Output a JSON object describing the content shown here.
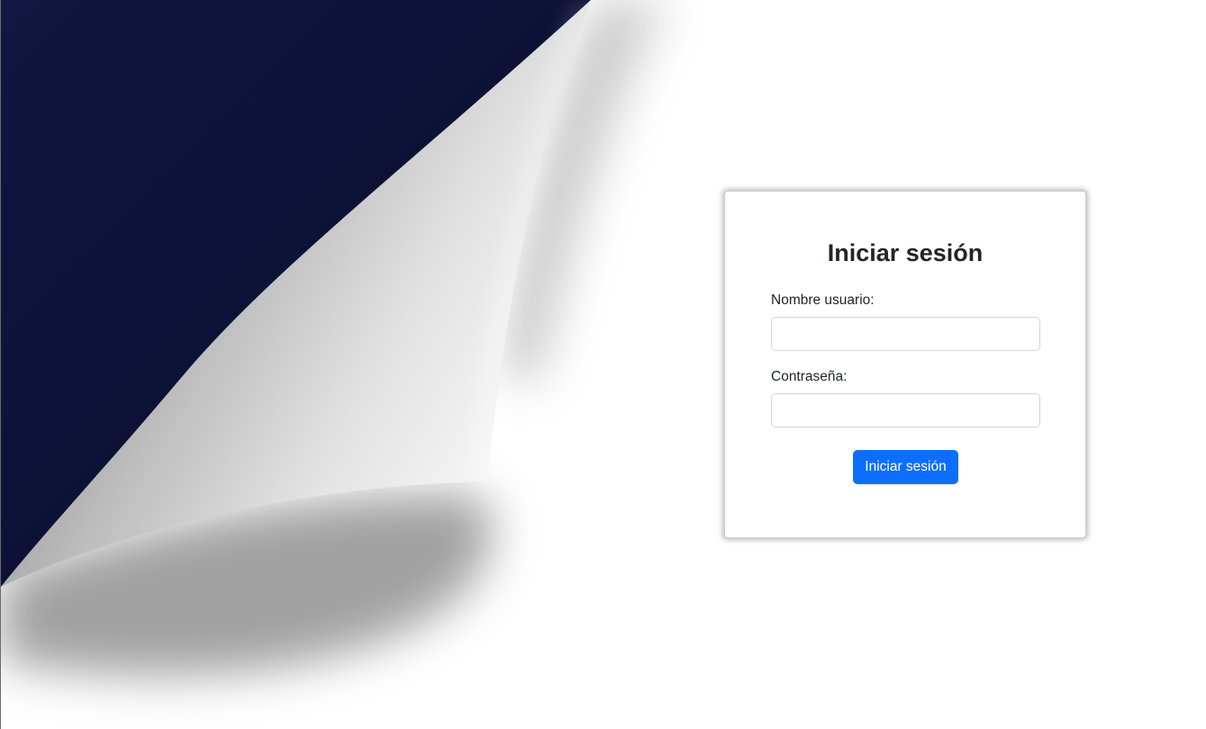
{
  "theme": {
    "background": "#ffffff",
    "navy": "#0c1030",
    "button": "#0d6efd",
    "button_text": "#ffffff"
  },
  "decoration": {
    "icon": "page-curl-decoration"
  },
  "login": {
    "title": "Iniciar sesión",
    "username_label": "Nombre usuario:",
    "username_value": "",
    "password_label": "Contraseña:",
    "password_value": "",
    "submit_label": "Iniciar sesión"
  }
}
